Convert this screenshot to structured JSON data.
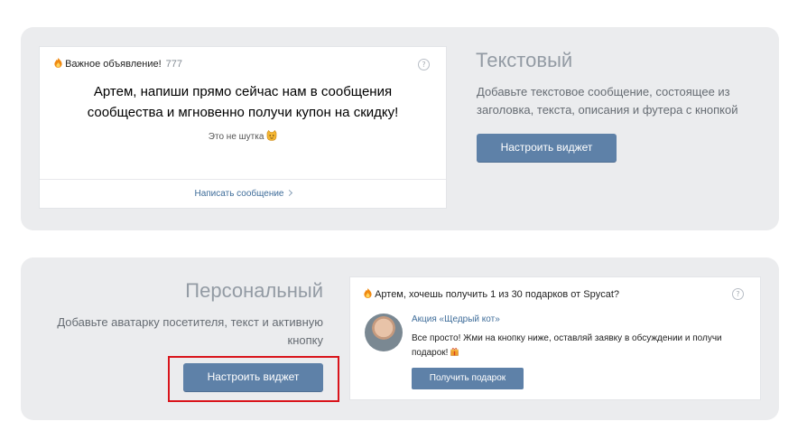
{
  "text_widget": {
    "preview": {
      "header_label": "Важное объявление!",
      "header_count": "777",
      "help_glyph": "?",
      "title": "Артем, напиши прямо сейчас нам в сообщения сообщества и мгновенно получи купон на скидку!",
      "description": "Это не шутка",
      "footer_link": "Написать сообщение"
    },
    "title": "Текстовый",
    "description": "Добавьте текстовое сообщение, состоящее из заголовка, текста, описания и футера с кнопкой",
    "button_label": "Настроить виджет"
  },
  "personal_widget": {
    "title": "Персональный",
    "description": "Добавьте аватарку посетителя, текст и активную кнопку",
    "button_label": "Настроить виджет",
    "preview": {
      "header": "Артем, хочешь получить 1 из 30 подарков от Spycat?",
      "help_glyph": "?",
      "name": "Акция «Щедрый кот»",
      "text": "Все просто! Жми на кнопку ниже, оставляй заявку в обсуждении и получи подарок!",
      "button_label": "Получить подарок"
    }
  },
  "colors": {
    "accent_button": "#5e81a8",
    "highlight_border": "#d9141b",
    "card_background": "#ebecee",
    "link": "#3f6d9a"
  },
  "icons": [
    "fire-icon",
    "help-icon",
    "cat-emoji-icon",
    "chevron-right-icon",
    "gift-icon"
  ]
}
